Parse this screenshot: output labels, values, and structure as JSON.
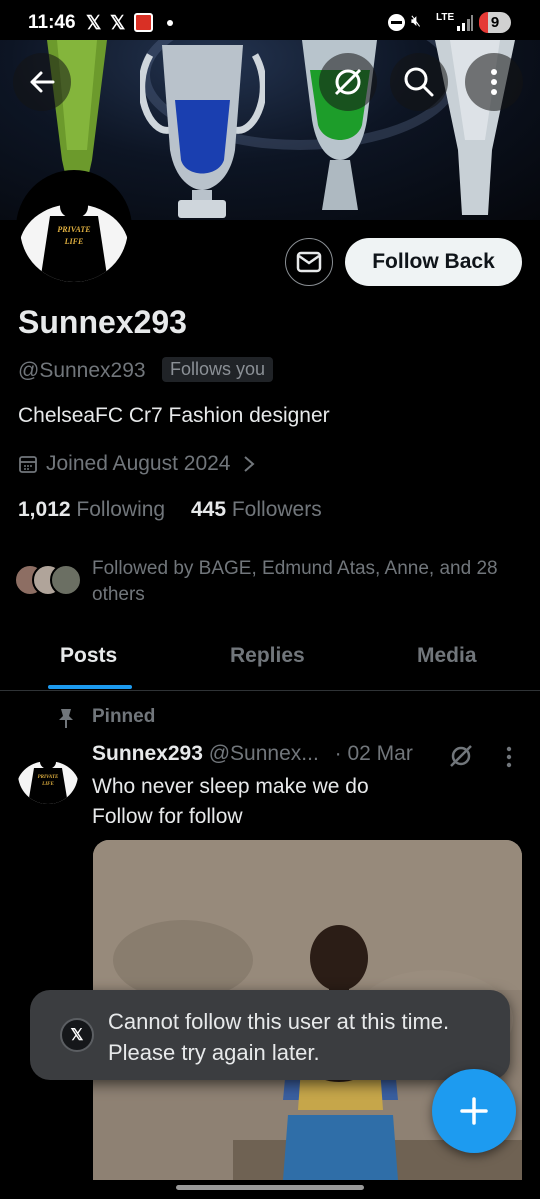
{
  "status_bar": {
    "time": "11:46",
    "network": "LTE",
    "battery": "9"
  },
  "profile": {
    "avatar_text": "Private Life",
    "name": "Sunnex293",
    "handle": "@Sunnex293",
    "follows_you": "Follows you",
    "bio": "ChelseaFC  Cr7 Fashion designer",
    "joined": "Joined August 2024",
    "following_count": "1,012",
    "following_label": "Following",
    "followers_count": "445",
    "followers_label": "Followers",
    "followed_by": "Followed by BAGE, Edmund Atas, Anne, and 28 others"
  },
  "actions": {
    "follow_back": "Follow Back"
  },
  "tabs": [
    {
      "label": "Posts"
    },
    {
      "label": "Replies"
    },
    {
      "label": "Media"
    }
  ],
  "post": {
    "pinned_label": "Pinned",
    "author": "Sunnex293",
    "handle": "@Sunnex...",
    "date": "· 02 Mar",
    "line1": "Who never sleep make we do",
    "line2": "Follow for follow"
  },
  "toast": {
    "message": "Cannot follow this user at this time. Please try again later."
  },
  "colors": {
    "accent": "#1d9bf0",
    "background": "#000000",
    "muted": "#71767b"
  }
}
